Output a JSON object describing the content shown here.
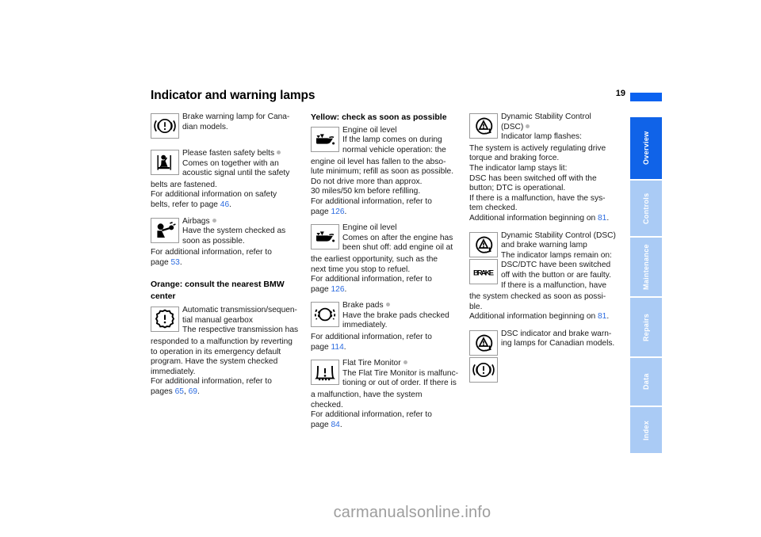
{
  "header": {
    "title": "Indicator and warning lamps",
    "page_number": "19",
    "accent_color": "#0a62f0"
  },
  "columns": {
    "column1": {
      "entries": [
        {
          "icon": "brake-warning-canadian-icon",
          "title": "Brake warning lamp for Cana-",
          "line2": "dian models."
        },
        {
          "icon": "safety-belt-icon",
          "title": "Please fasten safety belts",
          "has_dot": true,
          "line2": "Comes on together with an",
          "line3": "acoustic signal until the safety",
          "after": "belts are fastened.",
          "after2": "For additional information on safety",
          "after3_pre": "belts, refer to page ",
          "after3_page": "46",
          "after3_post": "."
        },
        {
          "icon": "airbags-icon",
          "title": "Airbags",
          "has_dot": true,
          "line2": "Have the system checked as",
          "line3": "soon as possible.",
          "after": "For additional information, refer to",
          "after2_pre": "page ",
          "after2_page": "53",
          "after2_post": "."
        }
      ],
      "section_heading_line1": "Orange: consult the nearest BMW",
      "section_heading_line2": "center",
      "entries2": [
        {
          "icon": "automatic-transmission-icon",
          "title": "Automatic transmission/sequen-",
          "line2": "tial manual gearbox",
          "line3": "The respective transmission has",
          "after": "responded to a malfunction by reverting",
          "after2": "to operation in its emergency default",
          "after3": "program. Have the system checked",
          "after4": "immediately.",
          "after5": "For additional information, refer to",
          "after6_pre": "pages ",
          "after6_page1": "65",
          "after6_mid": ", ",
          "after6_page2": "69",
          "after6_post": "."
        }
      ]
    },
    "column2": {
      "section_heading": "Yellow: check as soon as possible",
      "entries": [
        {
          "icon": "engine-oil-icon",
          "title": "Engine oil level",
          "line2": "If the lamp comes on during",
          "line3": "normal vehicle operation: the",
          "after": "engine oil level has fallen to the abso-",
          "after2": "lute minimum; refill as soon as possible.",
          "after3": "Do not drive more than approx.",
          "after4": "30 miles/50 km before refilling.",
          "after5": "For additional information, refer to",
          "after6_pre": "page ",
          "after6_page": "126",
          "after6_post": "."
        },
        {
          "icon": "engine-oil-icon",
          "title": "Engine oil level",
          "line2": "Comes on after the engine has",
          "line3": "been shut off: add engine oil at",
          "after": "the earliest opportunity, such as the",
          "after2": "next time you stop to refuel.",
          "after3": "For additional information, refer to",
          "after4_pre": "page ",
          "after4_page": "126",
          "after4_post": "."
        },
        {
          "icon": "brake-pads-icon",
          "title": "Brake pads",
          "has_dot": true,
          "line2": "Have the brake pads checked",
          "line3": "immediately.",
          "after": "For additional information, refer to",
          "after2_pre": "page ",
          "after2_page": "114",
          "after2_post": "."
        },
        {
          "icon": "flat-tire-monitor-icon",
          "title": "Flat Tire Monitor",
          "has_dot": true,
          "line2": "The Flat Tire Monitor is malfunc-",
          "line3": "tioning or out of order. If there is",
          "after": "a malfunction, have the system",
          "after2": "checked.",
          "after3": "For additional information, refer to",
          "after4_pre": "page ",
          "after4_page": "84",
          "after4_post": "."
        }
      ]
    },
    "column3": {
      "entries": [
        {
          "icon": "dsc-icon",
          "title": "Dynamic Stability Control",
          "line2": "(DSC)",
          "has_dot": true,
          "line3": "Indicator lamp flashes:",
          "after": "The system is actively regulating drive",
          "after2": "torque and braking force.",
          "after3": "The indicator lamp stays lit:",
          "after4": "DSC has been switched off with the",
          "after5": "button; DTC is operational.",
          "after6": "If there is a malfunction, have the sys-",
          "after7": "tem checked.",
          "after8_pre": "Additional information beginning on ",
          "after8_page": "81",
          "after8_post": "."
        },
        {
          "icon": "dsc-brake-pair-icon",
          "title": "Dynamic Stability Control (DSC)",
          "line2": "and brake warning lamp",
          "line3": "The indicator lamps remain on:",
          "line4": "DSC/DTC have been switched",
          "line5": "off with the button or are faulty.",
          "line6": "If there is a malfunction, have",
          "after": "the system checked as soon as possi-",
          "after2": "ble.",
          "after3_pre": "Additional information beginning on ",
          "after3_page": "81",
          "after3_post": "."
        },
        {
          "icon": "dsc-brake-canadian-icon",
          "title": "DSC indicator and brake warn-",
          "line2": "ing lamps for Canadian models."
        }
      ]
    }
  },
  "side_tabs": [
    {
      "label": "Overview",
      "active": true,
      "bg": "#1063e8",
      "height": 78
    },
    {
      "label": "Controls",
      "active": false,
      "bg": "#aacbf5",
      "height": 70
    },
    {
      "label": "Maintenance",
      "active": false,
      "bg": "#aacbf5",
      "height": 74
    },
    {
      "label": "Repairs",
      "active": false,
      "bg": "#aacbf5",
      "height": 74
    },
    {
      "label": "Data",
      "active": false,
      "bg": "#aacbf5",
      "height": 60
    },
    {
      "label": "Index",
      "active": false,
      "bg": "#aacbf5",
      "height": 58
    }
  ],
  "watermark": "carmanualsonline.info"
}
